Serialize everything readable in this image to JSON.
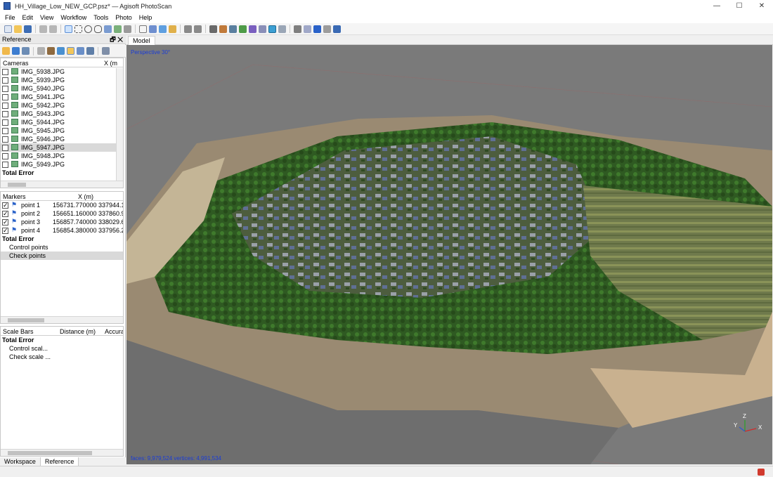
{
  "window": {
    "title": "HH_Village_Low_NEW_GCP.psz* — Agisoft PhotoScan",
    "minimize": "—",
    "maximize": "☐",
    "close": "✕"
  },
  "menu": [
    "File",
    "Edit",
    "View",
    "Workflow",
    "Tools",
    "Photo",
    "Help"
  ],
  "reference_panel": {
    "title": "Reference",
    "title_buttons": "🗗 ✕",
    "cameras": {
      "header": "Cameras",
      "col_x": "X (m",
      "items": [
        "IMG_5938.JPG",
        "IMG_5939.JPG",
        "IMG_5940.JPG",
        "IMG_5941.JPG",
        "IMG_5942.JPG",
        "IMG_5943.JPG",
        "IMG_5944.JPG",
        "IMG_5945.JPG",
        "IMG_5946.JPG",
        "IMG_5947.JPG",
        "IMG_5948.JPG",
        "IMG_5949.JPG"
      ],
      "selected_index": 9,
      "total": "Total Error"
    },
    "markers": {
      "header": "Markers",
      "col_x": "X (m)",
      "items": [
        {
          "name": "point 1",
          "x": "156731.770000",
          "y": "337944.1("
        },
        {
          "name": "point 2",
          "x": "156651.160000",
          "y": "337860.9!"
        },
        {
          "name": "point 3",
          "x": "156857.740000",
          "y": "338029.6("
        },
        {
          "name": "point 4",
          "x": "156854.380000",
          "y": "337956.2("
        }
      ],
      "total": "Total Error",
      "control": "Control points",
      "check": "Check points"
    },
    "scale_bars": {
      "header": "Scale Bars",
      "col_distance": "Distance (m)",
      "col_accuracy": "Accurac",
      "total": "Total Error",
      "control": "Control scal...",
      "check": "Check scale ..."
    }
  },
  "bottom_tabs": [
    "Workspace",
    "Reference"
  ],
  "model_view": {
    "tab": "Model",
    "projection": "Perspective 30°",
    "stats": "faces: 9,979,524 vertices: 4,991,534",
    "axis_labels": {
      "x": "X",
      "y": "Y",
      "z": "Z"
    }
  },
  "colors": {
    "viewport_bg": "#7a7a7a",
    "overlay_text": "#1a3cd6",
    "selection": "#d9d9d9"
  }
}
